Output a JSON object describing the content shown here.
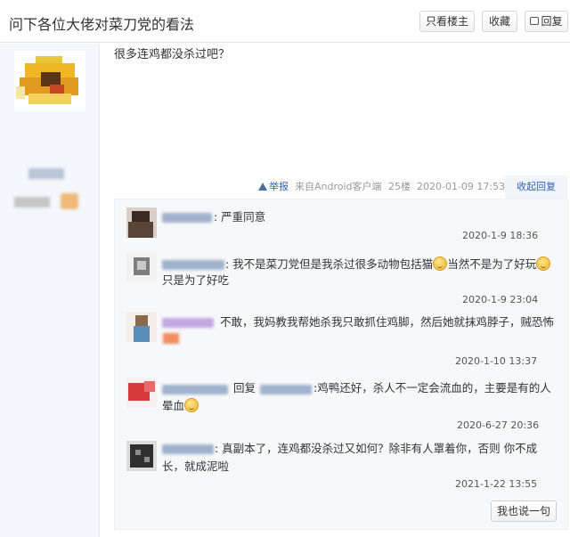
{
  "header": {
    "title": "问下各位大佬对菜刀党的看法",
    "only_op_label": "只看楼主",
    "favorite_label": "收藏",
    "reply_label": "回复"
  },
  "post": {
    "text": "很多连鸡都没杀过吧？",
    "report_label": "举报",
    "client": "来自Android客户端",
    "floor": "25楼",
    "time": "2020-01-09 17:53",
    "collapse_label": "收起回复"
  },
  "comments": [
    {
      "text": ": 严重同意",
      "time": "2020-1-9 18:36"
    },
    {
      "text_a": ": 我不是菜刀党但是我杀过很多动物包括猫",
      "text_b": "当然不是为了好玩",
      "text_c": "只是为了好吃",
      "time": "2020-1-9 23:04"
    },
    {
      "text": "不敢，我妈教我帮她杀我只敢抓住鸡脚，然后她就抹鸡脖子，贼恐怖",
      "time": "2020-1-10 13:37"
    },
    {
      "reply_word": "回复",
      "text_a": ":鸡鸭还好，杀人不一定会流血的，主要是有的人",
      "text_b": "晕血",
      "time": "2020-6-27 20:36"
    },
    {
      "text_a": ": 真副本了，连鸡都没杀过又如何？除非有人罩着你，否则 你不成",
      "text_b": "长，就成泥啦",
      "time": "2021-1-22 13:55"
    }
  ],
  "say_button_label": "我也说一句"
}
